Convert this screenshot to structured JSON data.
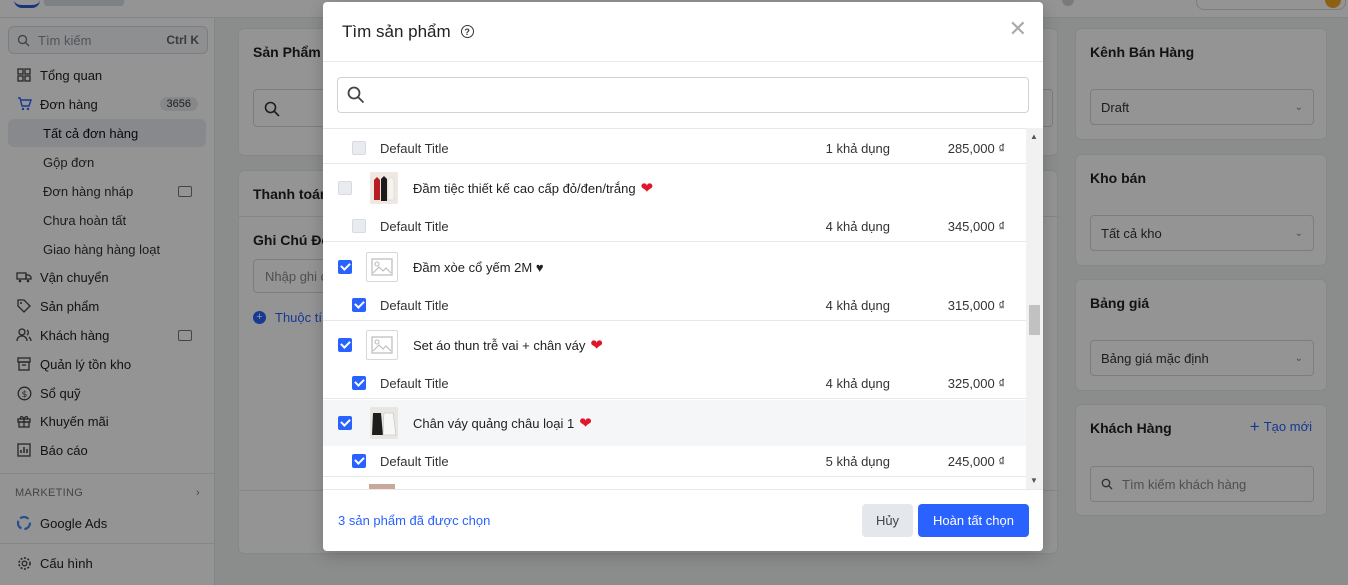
{
  "sidebar": {
    "search_placeholder": "Tìm kiếm",
    "search_shortcut": "Ctrl K",
    "items": [
      {
        "label": "Tổng quan"
      },
      {
        "label": "Đơn hàng",
        "badge": "3656"
      },
      {
        "label": "Vận chuyển"
      },
      {
        "label": "Sản phẩm"
      },
      {
        "label": "Khách hàng"
      },
      {
        "label": "Quản lý tồn kho"
      },
      {
        "label": "Sổ quỹ"
      },
      {
        "label": "Khuyến mãi"
      },
      {
        "label": "Báo cáo"
      }
    ],
    "order_subitems": [
      {
        "label": "Tất cả đơn hàng"
      },
      {
        "label": "Gộp đơn"
      },
      {
        "label": "Đơn hàng nháp"
      },
      {
        "label": "Chưa hoàn tất"
      },
      {
        "label": "Giao hàng hàng loạt"
      }
    ],
    "section_marketing": "MARKETING",
    "google_ads": "Google Ads",
    "settings": "Cấu hình"
  },
  "main": {
    "products_title": "Sản Phẩm",
    "payment_title": "Thanh toán",
    "note_title": "Ghi Chú Đơn",
    "note_placeholder": "Nhập ghi c",
    "add_attr": "Thuộc tí"
  },
  "right": {
    "channel_title": "Kênh Bán Hàng",
    "channel_value": "Draft",
    "warehouse_title": "Kho bán",
    "warehouse_value": "Tất cả kho",
    "pricelist_title": "Bảng giá",
    "pricelist_value": "Bảng giá mặc định",
    "customer_title": "Khách Hàng",
    "customer_create": "Tạo mới",
    "customer_search_placeholder": "Tìm kiếm khách hàng"
  },
  "modal": {
    "title": "Tìm sản phẩm",
    "selected_text": "3 sản phẩm đã được chọn",
    "cancel": "Hủy",
    "confirm": "Hoàn tất chọn",
    "rows": [
      {
        "kind": "variant",
        "name": "Default Title",
        "available": "1 khả dụng",
        "price": "285,000 ₫",
        "checked": false
      },
      {
        "kind": "product",
        "name": "Đầm tiệc thiết kế cao cấp đỏ/đen/trắng",
        "heart": "❤",
        "checked": false,
        "image": "photo-red"
      },
      {
        "kind": "variant",
        "name": "Default Title",
        "available": "4 khả dụng",
        "price": "345,000 ₫",
        "checked": false
      },
      {
        "kind": "product",
        "name": "Đầm xòe cổ yếm 2M ♥",
        "heart": "",
        "checked": true,
        "image": "placeholder"
      },
      {
        "kind": "variant",
        "name": "Default Title",
        "available": "4 khả dụng",
        "price": "315,000 ₫",
        "checked": true
      },
      {
        "kind": "product",
        "name": "Set áo thun trễ vai + chân váy",
        "heart": "❤",
        "checked": true,
        "image": "placeholder"
      },
      {
        "kind": "variant",
        "name": "Default Title",
        "available": "4 khả dụng",
        "price": "325,000 ₫",
        "checked": true
      },
      {
        "kind": "product",
        "name": "Chân váy quảng châu loại 1",
        "heart": "❤",
        "checked": true,
        "image": "photo-bw"
      },
      {
        "kind": "variant",
        "name": "Default Title",
        "available": "5 khả dụng",
        "price": "245,000 ₫",
        "checked": true
      }
    ]
  },
  "colors": {
    "primary": "#2962ff",
    "heart": "#e0162b"
  }
}
